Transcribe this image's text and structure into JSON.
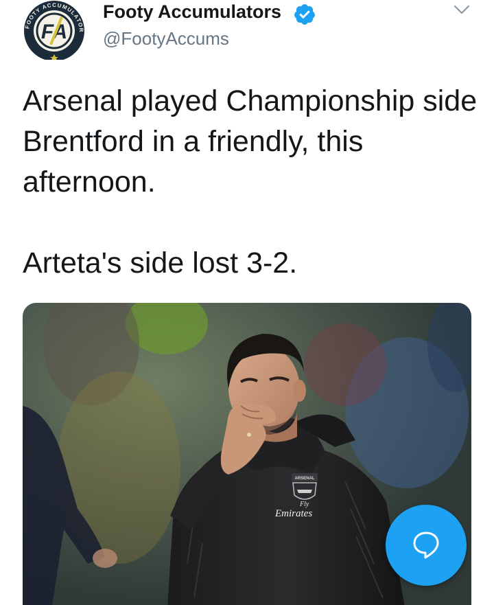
{
  "author": {
    "display_name": "Footy Accumulators",
    "handle": "@FootyAccums",
    "verified": true,
    "avatar_ring_text": "FOOTY ACCUMULATORS",
    "avatar_monogram": "FA"
  },
  "tweet": {
    "paragraphs": [
      "Arsenal played Championship side Brentford in a friendly, this afternoon.",
      "Arteta's side lost 3-2."
    ]
  },
  "media": {
    "jacket_badge": "ARSENAL",
    "sponsor_small": "Fly",
    "sponsor": "Emirates"
  },
  "icons": {
    "verified": "verified-badge-icon",
    "menu": "chevron-down-icon",
    "compose": "speech-bubble-icon"
  },
  "colors": {
    "accent": "#1da1f2",
    "text": "#14171a",
    "secondary_text": "#657786",
    "avatar_ring": "#1c2b3a",
    "avatar_gold": "#d4c33a"
  }
}
